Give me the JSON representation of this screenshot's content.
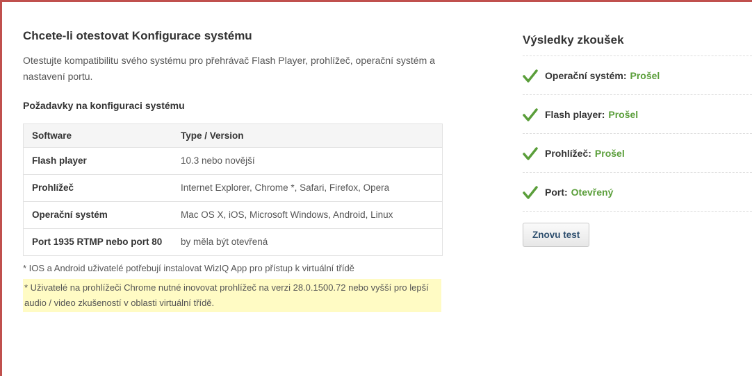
{
  "left": {
    "title": "Chcete-li otestovat Konfigurace systému",
    "intro": "Otestujte kompatibilitu svého systému pro přehrávač Flash Player, prohlížeč, operační systém a nastavení portu.",
    "requirements_title": "Požadavky na konfiguraci systému",
    "table": {
      "headers": [
        "Software",
        "Type / Version"
      ],
      "rows": [
        {
          "k": "Flash player",
          "v": "10.3 nebo novější"
        },
        {
          "k": "Prohlížeč",
          "v": "Internet Explorer, Chrome *, Safari, Firefox, Opera"
        },
        {
          "k": "Operační systém",
          "v": "Mac OS X, iOS, Microsoft Windows, Android, Linux"
        },
        {
          "k": "Port 1935 RTMP nebo port 80",
          "v": "by měla být otevřená"
        }
      ]
    },
    "note1": "* IOS a Android uživatelé potřebují instalovat WizIQ App pro přístup k virtuální třídě",
    "note2": "* Uživatelé na prohlížeči Chrome nutné inovovat prohlížeč na verzi 28.0.1500.72 nebo vyšší pro lepší audio / video zkušeností v oblasti virtuální třídě."
  },
  "right": {
    "title": "Výsledky zkoušek",
    "results": [
      {
        "label": "Operační systém:",
        "value": "Prošel"
      },
      {
        "label": "Flash player:",
        "value": "Prošel"
      },
      {
        "label": "Prohlížeč:",
        "value": "Prošel"
      },
      {
        "label": "Port:",
        "value": "Otevřený"
      }
    ],
    "retest_label": "Znovu test"
  },
  "colors": {
    "accent_border": "#c0504d",
    "pass": "#5a9e3a",
    "highlight": "#fffbc4"
  },
  "icons": {
    "result_icon": "check-icon"
  }
}
